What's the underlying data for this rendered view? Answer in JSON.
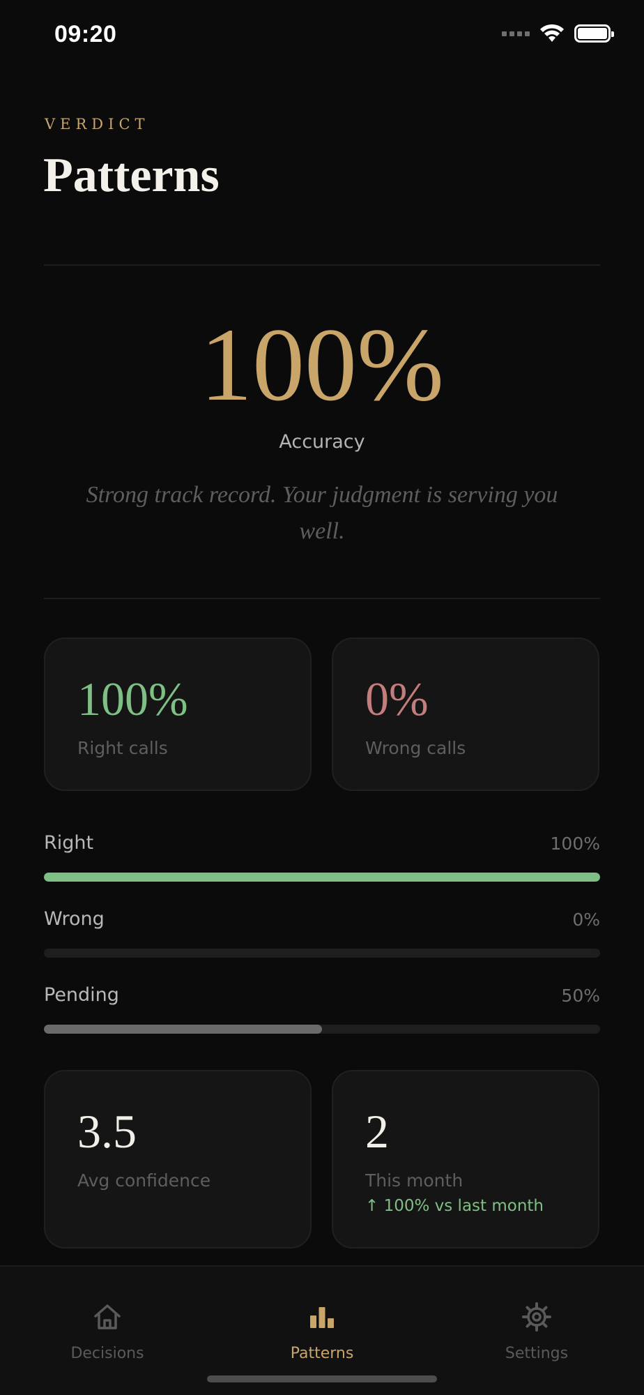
{
  "status_bar": {
    "time": "09:20"
  },
  "header": {
    "eyebrow": "VERDICT",
    "title": "Patterns"
  },
  "hero": {
    "value": "100%",
    "label": "Accuracy",
    "message": "Strong track record. Your judgment is serving you well."
  },
  "call_cards": [
    {
      "value": "100%",
      "label": "Right calls",
      "color": "#7fbf85"
    },
    {
      "value": "0%",
      "label": "Wrong calls",
      "color": "#c47d7d"
    }
  ],
  "breakdown": [
    {
      "label": "Right",
      "value": "100%",
      "fraction": 1.0,
      "color": "#7fbf85"
    },
    {
      "label": "Wrong",
      "value": "0%",
      "fraction": 0.0,
      "color": "#c47d7d"
    },
    {
      "label": "Pending",
      "value": "50%",
      "fraction": 0.5,
      "color": "#6a6a6a"
    }
  ],
  "stat_cards": [
    {
      "value": "3.5",
      "label": "Avg confidence"
    },
    {
      "value": "2",
      "label": "This month",
      "trend": "↑ 100% vs last month"
    }
  ],
  "tabs": [
    {
      "label": "Decisions",
      "icon": "home-icon",
      "active": false
    },
    {
      "label": "Patterns",
      "icon": "bar-chart-icon",
      "active": true
    },
    {
      "label": "Settings",
      "icon": "gear-icon",
      "active": false
    }
  ],
  "colors": {
    "accent": "#c9a56a",
    "positive": "#7fbf85",
    "negative": "#c47d7d",
    "inactive_tab": "#5a5a5a",
    "background": "#0b0b0b"
  }
}
